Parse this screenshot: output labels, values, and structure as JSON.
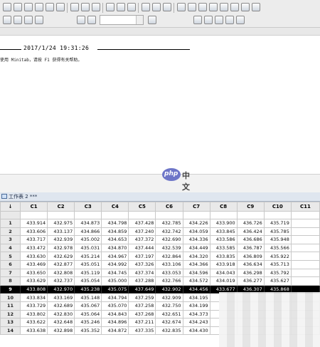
{
  "toolbar": {
    "icons_row1": [
      "new-icon",
      "open-icon",
      "save-icon",
      "print-icon",
      "cut-icon",
      "copy-icon",
      "paste-icon",
      "undo-icon",
      "redo-icon",
      "cancel-icon",
      "previous-command-icon",
      "next-command-icon",
      "help-icon",
      "stop-icon",
      "info-icon",
      "session-folder-icon",
      "graph-icon",
      "worksheet-icon",
      "project-icon",
      "close-all-icon",
      "window-icon",
      "layout-icon",
      "tile-icon"
    ],
    "icons_row2": [
      "insert-row-icon",
      "insert-col-icon",
      "brush-icon",
      "edit-icon",
      "arrow-up-icon",
      "arrow-down-icon",
      "cross-icon",
      "plus-icon",
      "plus-icon",
      "plus-icon",
      "plus-icon",
      "plus-icon"
    ]
  },
  "session": {
    "datetime": "2017/1/24 19:31:26",
    "welcome": "使用 Minitab，请按 F1 获得有关帮助。"
  },
  "watermark": {
    "logo": "php",
    "text": "中文网"
  },
  "worksheet": {
    "title": "工作表 2 ***",
    "row_header_symbol": "↓",
    "columns": [
      "C1",
      "C2",
      "C3",
      "C4",
      "C5",
      "C6",
      "C7",
      "C8",
      "C9",
      "C10",
      "C11"
    ],
    "selected_row": "9",
    "rows": [
      {
        "n": "1",
        "v": [
          "433.914",
          "432.975",
          "434.873",
          "434.798",
          "437.428",
          "432.785",
          "434.226",
          "433.900",
          "436.726",
          "435.719",
          ""
        ]
      },
      {
        "n": "2",
        "v": [
          "433.606",
          "433.137",
          "434.866",
          "434.859",
          "437.240",
          "432.742",
          "434.059",
          "433.845",
          "436.424",
          "435.785",
          ""
        ]
      },
      {
        "n": "3",
        "v": [
          "433.717",
          "432.939",
          "435.002",
          "434.653",
          "437.372",
          "432.690",
          "434.336",
          "433.586",
          "436.686",
          "435.948",
          ""
        ]
      },
      {
        "n": "4",
        "v": [
          "433.472",
          "432.978",
          "435.031",
          "434.870",
          "437.444",
          "432.539",
          "434.449",
          "433.585",
          "436.787",
          "435.566",
          ""
        ]
      },
      {
        "n": "5",
        "v": [
          "433.630",
          "432.629",
          "435.214",
          "434.967",
          "437.197",
          "432.864",
          "434.320",
          "433.835",
          "436.809",
          "435.922",
          ""
        ]
      },
      {
        "n": "6",
        "v": [
          "433.469",
          "432.877",
          "435.051",
          "434.992",
          "437.326",
          "433.106",
          "434.366",
          "433.918",
          "436.634",
          "435.713",
          ""
        ]
      },
      {
        "n": "7",
        "v": [
          "433.650",
          "432.808",
          "435.119",
          "434.745",
          "437.374",
          "433.053",
          "434.596",
          "434.043",
          "436.298",
          "435.792",
          ""
        ]
      },
      {
        "n": "8",
        "v": [
          "433.629",
          "432.737",
          "435.054",
          "435.000",
          "437.288",
          "432.766",
          "434.572",
          "434.019",
          "436.277",
          "435.627",
          ""
        ]
      },
      {
        "n": "9",
        "v": [
          "433.808",
          "432.970",
          "435.238",
          "435.075",
          "437.649",
          "432.902",
          "434.456",
          "433.677",
          "436.307",
          "435.868",
          ""
        ]
      },
      {
        "n": "10",
        "v": [
          "433.834",
          "433.169",
          "435.148",
          "434.794",
          "437.259",
          "432.909",
          "434.195",
          "",
          "",
          "",
          ""
        ]
      },
      {
        "n": "11",
        "v": [
          "433.729",
          "432.689",
          "435.067",
          "435.070",
          "437.258",
          "432.750",
          "434.199",
          "",
          "",
          "",
          ""
        ]
      },
      {
        "n": "12",
        "v": [
          "433.802",
          "432.830",
          "435.064",
          "434.843",
          "437.268",
          "432.651",
          "434.373",
          "",
          "",
          "",
          ""
        ]
      },
      {
        "n": "13",
        "v": [
          "433.622",
          "432.648",
          "435.246",
          "434.896",
          "437.211",
          "432.674",
          "434.243",
          "",
          "",
          "",
          ""
        ]
      },
      {
        "n": "14",
        "v": [
          "433.638",
          "432.898",
          "435.352",
          "434.872",
          "437.335",
          "432.835",
          "434.430",
          "",
          "",
          "",
          ""
        ]
      }
    ]
  }
}
